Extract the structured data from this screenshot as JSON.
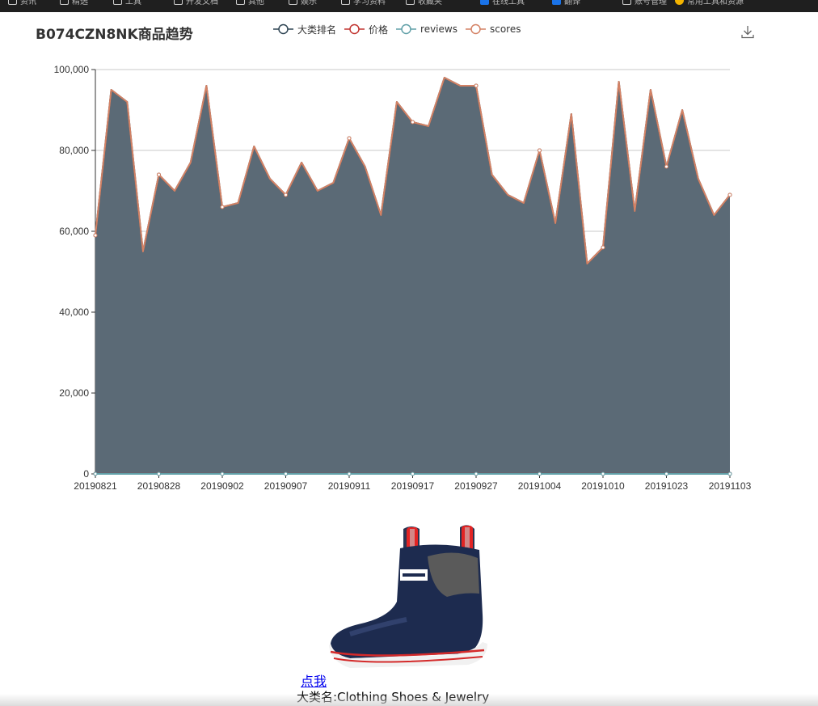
{
  "bookmarks": [
    {
      "label": "资讯",
      "icon": "folder-icon"
    },
    {
      "label": "精选",
      "icon": "folder-icon"
    },
    {
      "label": "工具",
      "icon": "folder-icon"
    },
    {
      "label": "开发文档",
      "icon": "folder-icon"
    },
    {
      "label": "其他",
      "icon": "folder-icon"
    },
    {
      "label": "娱乐",
      "icon": "folder-icon"
    },
    {
      "label": "学习资料",
      "icon": "folder-icon"
    },
    {
      "label": "收藏夹",
      "icon": "folder-icon"
    },
    {
      "label": "在线工具",
      "icon": "app-icon"
    },
    {
      "label": "翻译",
      "icon": "translate-icon"
    },
    {
      "label": "账号管理",
      "icon": "folder-icon"
    },
    {
      "label": "常用工具和资源",
      "icon": "coin-icon"
    }
  ],
  "chart": {
    "title": "B074CZN8NK商品趋势",
    "toolbox": {
      "download_icon": "download-icon"
    }
  },
  "chart_data": {
    "type": "area",
    "title": "B074CZN8NK商品趋势",
    "xlabel": "",
    "ylabel": "",
    "ylim": [
      0,
      100000
    ],
    "grid": true,
    "legend_position": "top",
    "y_ticks": [
      "0",
      "20,000",
      "40,000",
      "60,000",
      "80,000",
      "100,000"
    ],
    "x_tick_labels": [
      "20190821",
      "20190828",
      "20190902",
      "20190907",
      "20190911",
      "20190917",
      "20190927",
      "20191004",
      "20191010",
      "20191023",
      "20191103"
    ],
    "x_tick_indices": [
      0,
      4,
      8,
      12,
      16,
      20,
      24,
      28,
      32,
      36,
      40
    ],
    "series": [
      {
        "name": "大类排名",
        "color": "#2f4554",
        "area": true,
        "values": [
          59000,
          95000,
          92000,
          55000,
          74000,
          70000,
          77000,
          96000,
          66000,
          67000,
          81000,
          73000,
          69000,
          77000,
          70000,
          72000,
          83000,
          76000,
          64000,
          92000,
          87000,
          86000,
          98000,
          96000,
          96000,
          74000,
          69000,
          67000,
          80000,
          62000,
          89000,
          52000,
          56000,
          97000,
          65000,
          95000,
          76000,
          90000,
          73000,
          64000,
          69000
        ]
      },
      {
        "name": "价格",
        "color": "#c23531",
        "area": false,
        "values": [
          18,
          18,
          18,
          18,
          18,
          18,
          18,
          18,
          18,
          18,
          18,
          18,
          18,
          18,
          18,
          18,
          18,
          18,
          18,
          18,
          18,
          18,
          18,
          18,
          18,
          18,
          18,
          18,
          18,
          18,
          18,
          18,
          18,
          18,
          18,
          18,
          18,
          18,
          18,
          18,
          18
        ]
      },
      {
        "name": "reviews",
        "color": "#61a0a8",
        "area": false,
        "values": [
          0,
          0,
          0,
          0,
          0,
          0,
          0,
          0,
          0,
          0,
          0,
          0,
          0,
          0,
          0,
          0,
          0,
          0,
          0,
          0,
          0,
          0,
          0,
          0,
          0,
          0,
          0,
          0,
          0,
          0,
          0,
          0,
          0,
          0,
          0,
          0,
          0,
          0,
          0,
          0,
          0
        ]
      },
      {
        "name": "scores",
        "color": "#d48265",
        "area": false,
        "values": [
          59000,
          95000,
          92000,
          55000,
          74000,
          70000,
          77000,
          96000,
          66000,
          67000,
          81000,
          73000,
          69000,
          77000,
          70000,
          72000,
          83000,
          76000,
          64000,
          92000,
          87000,
          86000,
          98000,
          96000,
          96000,
          74000,
          69000,
          67000,
          80000,
          62000,
          89000,
          52000,
          56000,
          97000,
          65000,
          95000,
          76000,
          90000,
          73000,
          64000,
          69000
        ]
      }
    ]
  },
  "product": {
    "image_name": "boot-image",
    "link_text": "点我",
    "category_text": "大类名:Clothing Shoes & Jewelry"
  }
}
